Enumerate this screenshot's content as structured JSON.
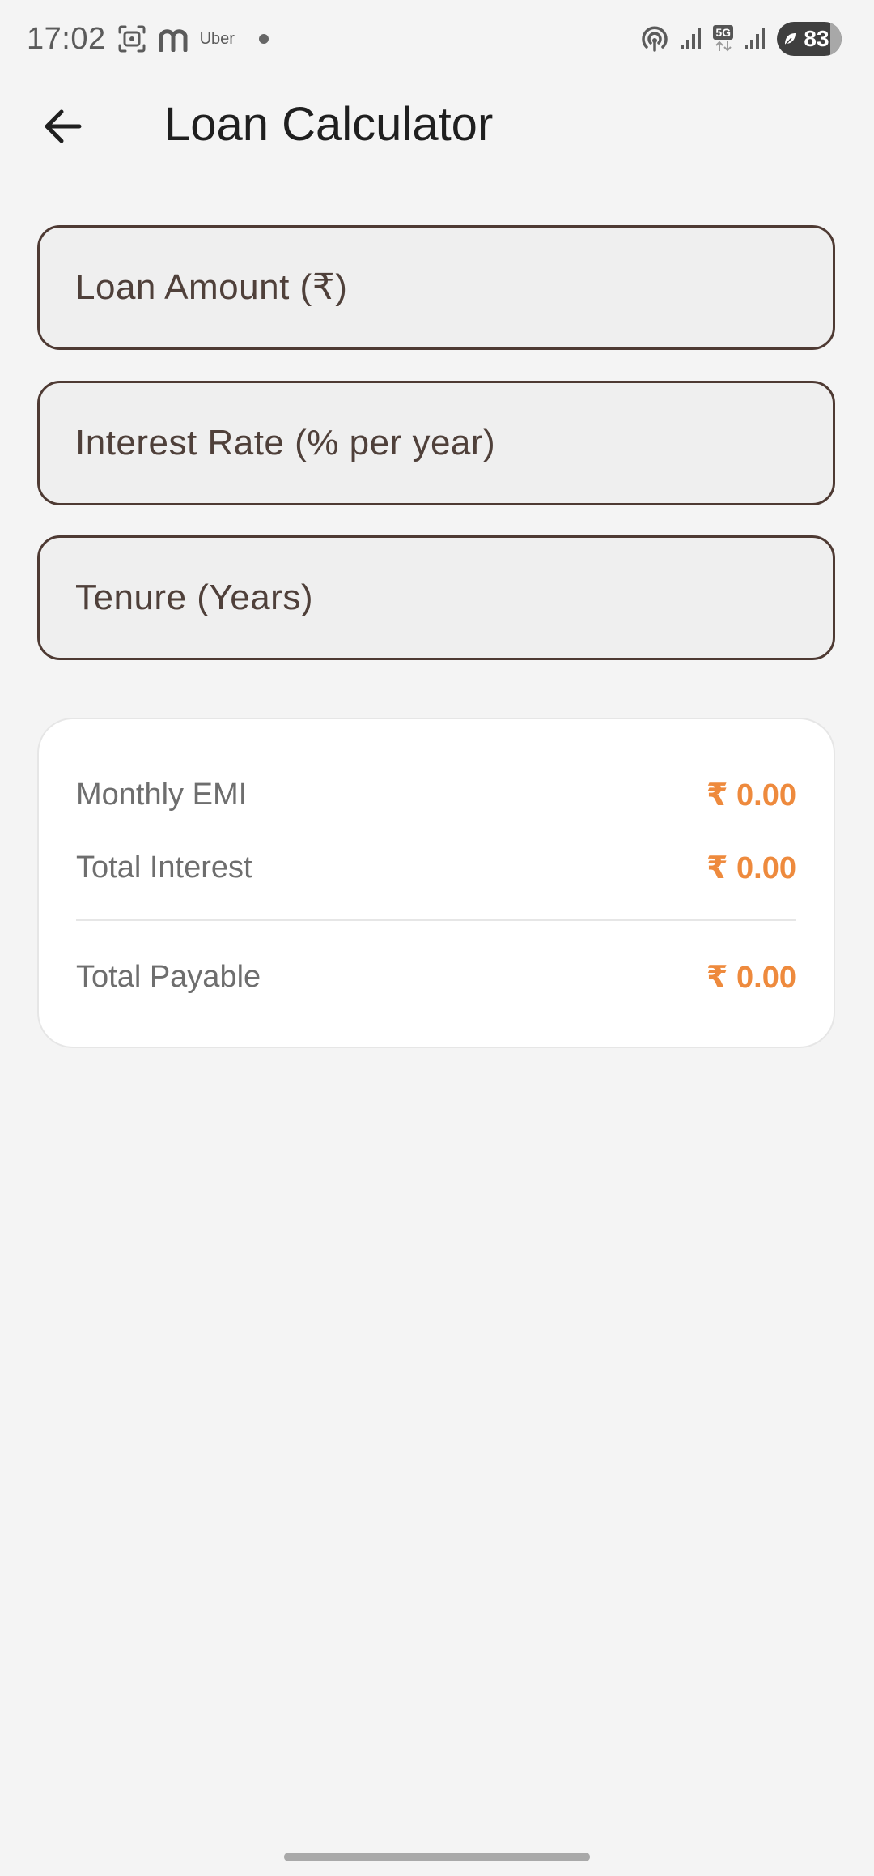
{
  "status_bar": {
    "time": "17:02",
    "uber_label": "Uber",
    "network_label": "5G",
    "battery_level": "83",
    "icons": [
      "screenshot-icon",
      "m-app-icon",
      "notification-dot-icon",
      "hotspot-icon",
      "signal-icon",
      "signal-icon",
      "battery-icon"
    ]
  },
  "app_bar": {
    "title": "Loan Calculator",
    "back_icon": "arrow-left-icon"
  },
  "form": {
    "loan_amount": {
      "placeholder": "Loan Amount (₹)",
      "value": ""
    },
    "interest_rate": {
      "placeholder": "Interest Rate (% per year)",
      "value": ""
    },
    "tenure": {
      "placeholder": "Tenure (Years)",
      "value": ""
    }
  },
  "results": {
    "monthly_emi": {
      "label": "Monthly EMI",
      "value": "₹ 0.00"
    },
    "total_interest": {
      "label": "Total Interest",
      "value": "₹ 0.00"
    },
    "total_payable": {
      "label": "Total Payable",
      "value": "₹ 0.00"
    }
  },
  "colors": {
    "accent": "#ee8a3d",
    "field_border": "#4e3a33",
    "background": "#f4f4f4",
    "card": "#ffffff"
  }
}
